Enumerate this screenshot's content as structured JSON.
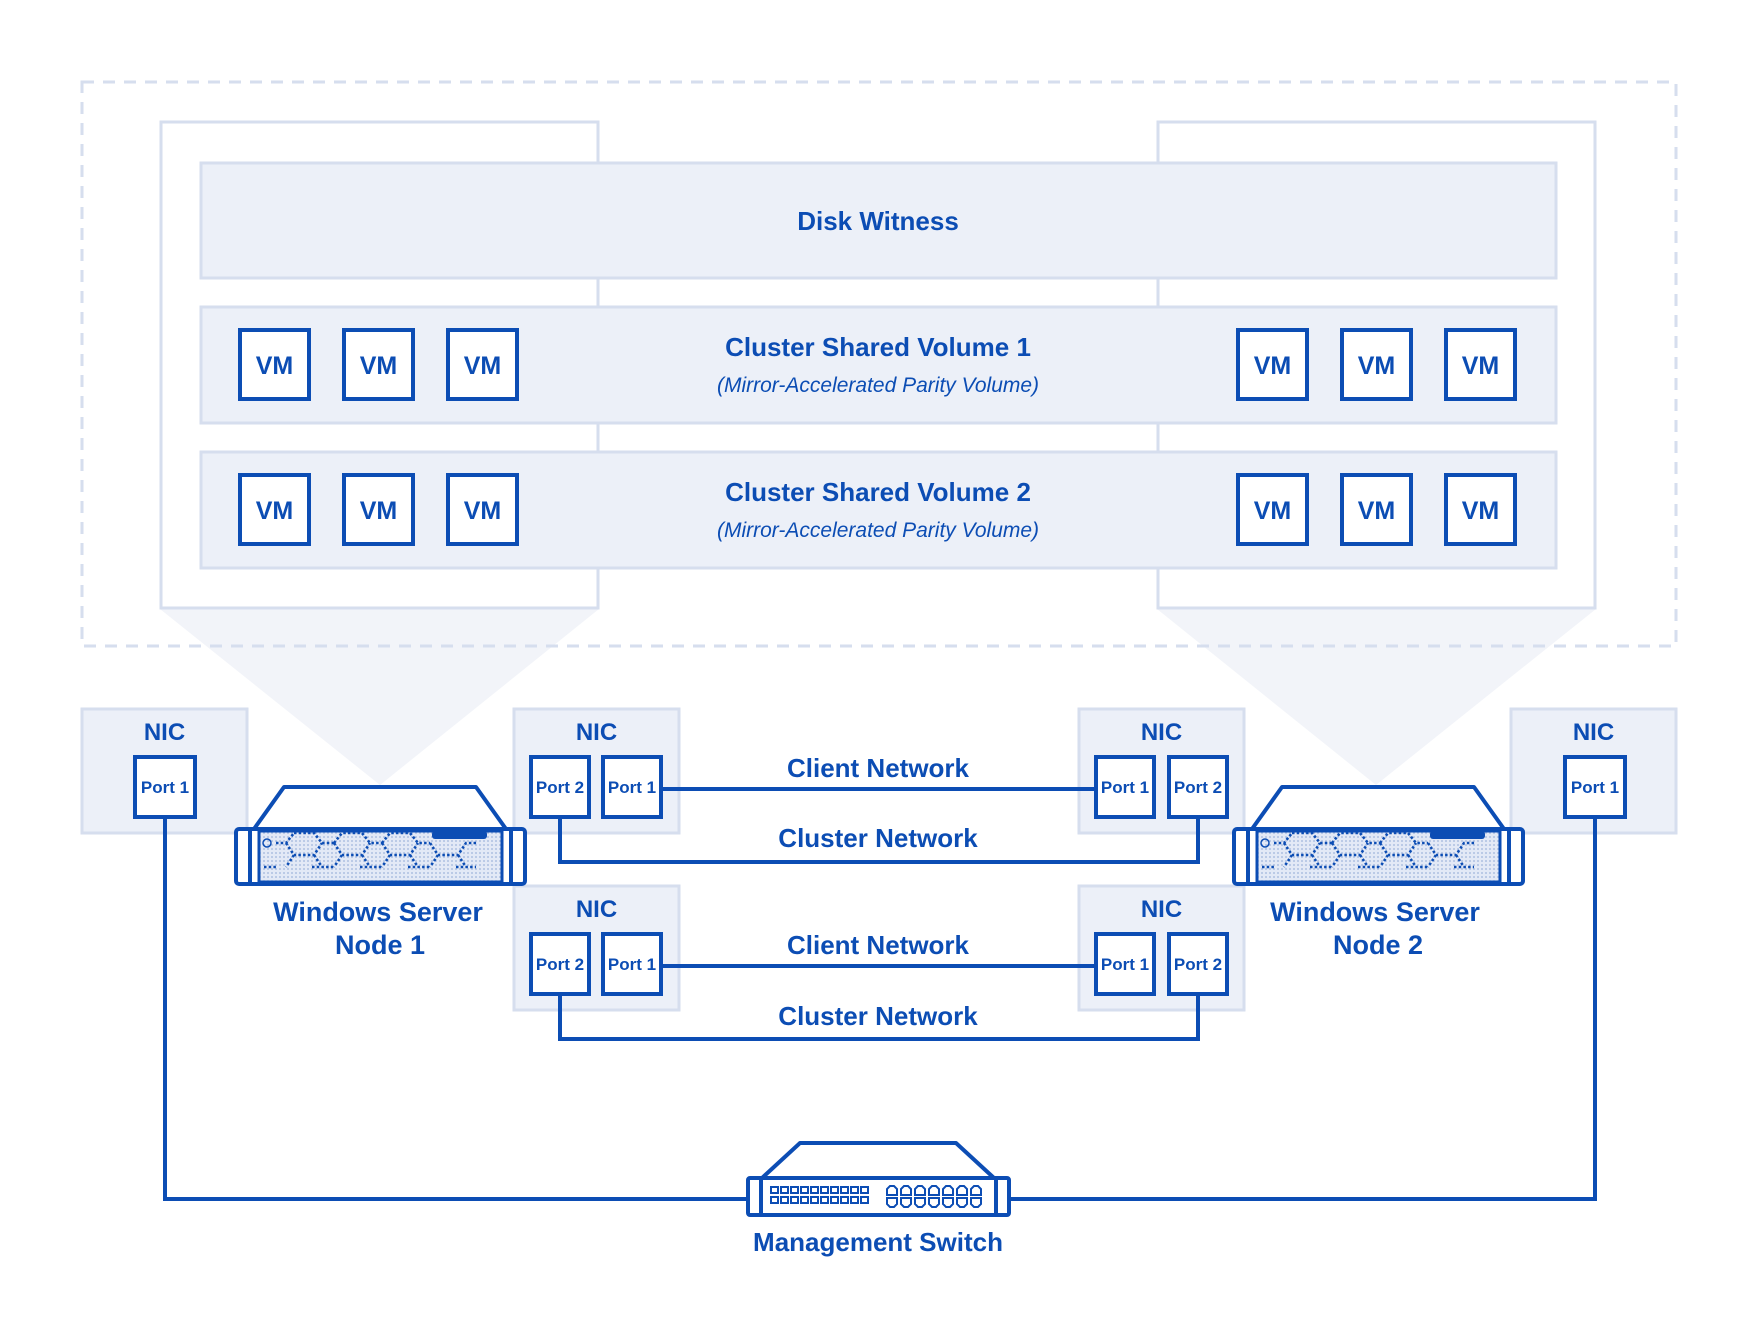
{
  "colors": {
    "primary": "#0c4db4",
    "panel_fill": "#ecf0f8",
    "panel_border": "#d6deee",
    "funnel_fill": "#f2f4f9",
    "background": "#ffffff"
  },
  "cluster": {
    "disk_witness": "Disk Witness",
    "volumes": [
      {
        "title": "Cluster Shared Volume 1",
        "subtitle": "(Mirror-Accelerated Parity Volume)",
        "vms_left": [
          "VM",
          "VM",
          "VM"
        ],
        "vms_right": [
          "VM",
          "VM",
          "VM"
        ]
      },
      {
        "title": "Cluster Shared Volume 2",
        "subtitle": "(Mirror-Accelerated Parity Volume)",
        "vms_left": [
          "VM",
          "VM",
          "VM"
        ],
        "vms_right": [
          "VM",
          "VM",
          "VM"
        ]
      }
    ]
  },
  "nodes": [
    {
      "line1": "Windows Server",
      "line2": "Node 1",
      "icon": "server-icon"
    },
    {
      "line1": "Windows Server",
      "line2": "Node 2",
      "icon": "server-icon"
    }
  ],
  "nics": {
    "label": "NIC",
    "mgmt_left": {
      "ports": [
        "Port 1"
      ]
    },
    "mgmt_right": {
      "ports": [
        "Port 1"
      ]
    },
    "node1_upper": {
      "ports": [
        "Port 2",
        "Port 1"
      ]
    },
    "node1_lower": {
      "ports": [
        "Port 2",
        "Port 1"
      ]
    },
    "node2_upper": {
      "ports": [
        "Port 1",
        "Port 2"
      ]
    },
    "node2_lower": {
      "ports": [
        "Port 1",
        "Port 2"
      ]
    }
  },
  "networks": {
    "upper": {
      "client": "Client Network",
      "cluster": "Cluster Network"
    },
    "lower": {
      "client": "Client Network",
      "cluster": "Cluster Network"
    }
  },
  "switch": {
    "label": "Management Switch",
    "icon": "network-switch-icon"
  }
}
